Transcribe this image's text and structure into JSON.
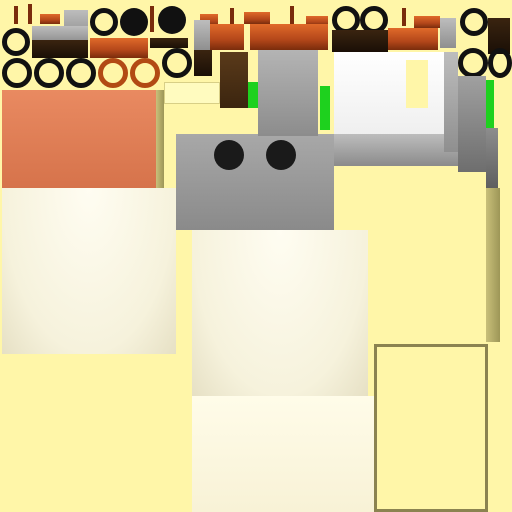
{
  "texture_atlas": {
    "background_color": "#fff6a8",
    "palette": {
      "cream": "#fffde9",
      "salmon": "#e3825a",
      "grey": "#9a9a9a",
      "rust": "#c05320",
      "green": "#1ed11e",
      "black": "#111111"
    }
  }
}
